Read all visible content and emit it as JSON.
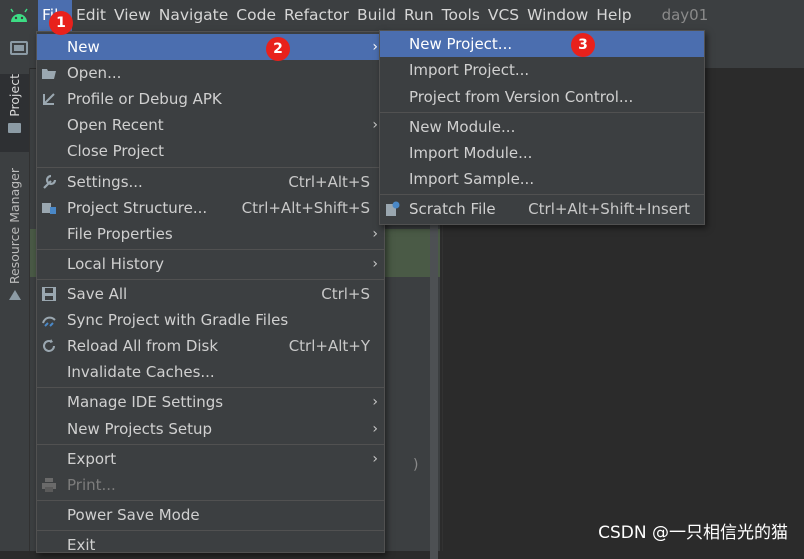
{
  "menubar": {
    "items": [
      "File",
      "Edit",
      "View",
      "Navigate",
      "Code",
      "Refactor",
      "Build",
      "Run",
      "Tools",
      "VCS",
      "Window",
      "Help"
    ],
    "project_name": "day01"
  },
  "sidebar": {
    "project_tab": "Project",
    "resource_tab": "Resource Manager"
  },
  "file_menu": {
    "new": "New",
    "open": "Open...",
    "profile_debug_apk": "Profile or Debug APK",
    "open_recent": "Open Recent",
    "close_project": "Close Project",
    "settings": "Settings...",
    "settings_shortcut": "Ctrl+Alt+S",
    "project_structure": "Project Structure...",
    "project_structure_shortcut": "Ctrl+Alt+Shift+S",
    "file_properties": "File Properties",
    "local_history": "Local History",
    "save_all": "Save All",
    "save_all_shortcut": "Ctrl+S",
    "sync_gradle": "Sync Project with Gradle Files",
    "reload_disk": "Reload All from Disk",
    "reload_disk_shortcut": "Ctrl+Alt+Y",
    "invalidate_caches": "Invalidate Caches...",
    "manage_ide_settings": "Manage IDE Settings",
    "new_projects_setup": "New Projects Setup",
    "export": "Export",
    "print": "Print...",
    "power_save_mode": "Power Save Mode",
    "exit": "Exit"
  },
  "new_submenu": {
    "new_project": "New Project...",
    "import_project": "Import Project...",
    "project_from_vcs": "Project from Version Control...",
    "new_module": "New Module...",
    "import_module": "Import Module...",
    "import_sample": "Import Sample...",
    "scratch_file": "Scratch File",
    "scratch_file_shortcut": "Ctrl+Alt+Shift+Insert"
  },
  "annotations": {
    "badge1": "1",
    "badge2": "2",
    "badge3": "3"
  },
  "editor": {
    "paren": ")"
  },
  "watermark": "CSDN @一只相信光的猫",
  "colors": {
    "selection": "#4b6eaf",
    "menu_bg": "#3c3f41",
    "badge": "#e8211c",
    "logo": "#3ddc84"
  }
}
